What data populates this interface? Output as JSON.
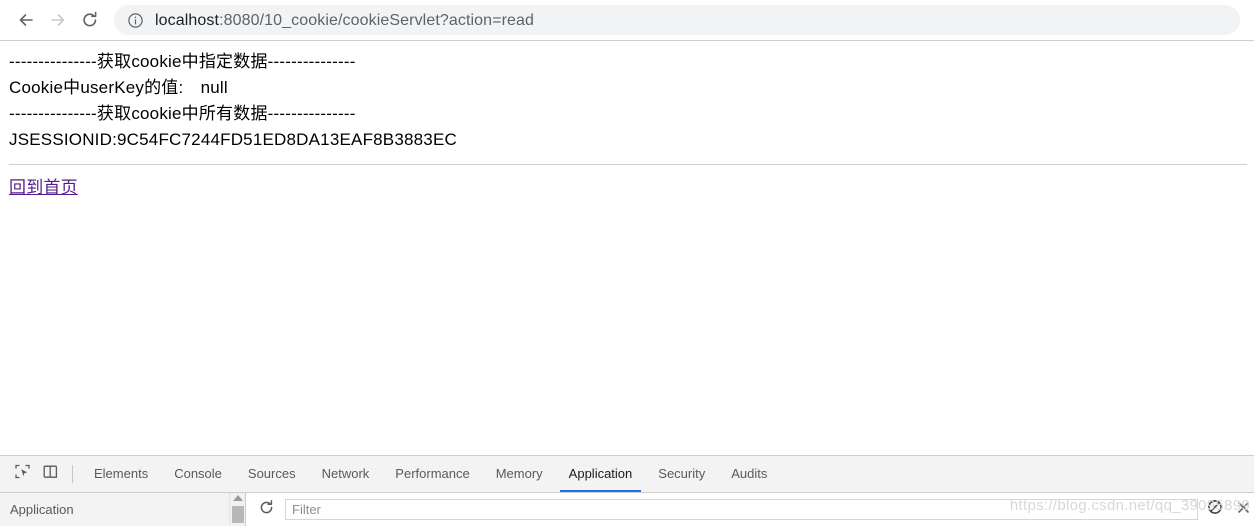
{
  "browser": {
    "back_icon": "back-arrow-icon",
    "forward_icon": "forward-arrow-icon",
    "reload_icon": "reload-icon",
    "site_info_icon": "info-circle-icon",
    "url_host": "localhost",
    "url_rest": ":8080/10_cookie/cookieServlet?action=read",
    "url_full": "localhost:8080/10_cookie/cookieServlet?action=read"
  },
  "page": {
    "lines": [
      "---------------获取cookie中指定数据---------------",
      "Cookie中userKey的值:　null",
      "---------------获取cookie中所有数据---------------",
      "JSESSIONID:9C54FC7244FD51ED8DA13EAF8B3883EC"
    ],
    "link_label": "回到首页",
    "link_color": "#551a8b"
  },
  "devtools": {
    "inspect_icon": "inspect-element-icon",
    "device_icon": "device-toolbar-icon",
    "tabs": [
      {
        "label": "Elements",
        "active": false
      },
      {
        "label": "Console",
        "active": false
      },
      {
        "label": "Sources",
        "active": false
      },
      {
        "label": "Network",
        "active": false
      },
      {
        "label": "Performance",
        "active": false
      },
      {
        "label": "Memory",
        "active": false
      },
      {
        "label": "Application",
        "active": true
      },
      {
        "label": "Security",
        "active": false
      },
      {
        "label": "Audits",
        "active": false
      }
    ],
    "active_tab": "Application",
    "active_underline_color": "#1a73e8",
    "sidebar_label": "Application",
    "refresh_icon": "refresh-icon",
    "filter_placeholder": "Filter",
    "filter_value": "",
    "clear_icon": "clear-ban-icon",
    "close_icon": "close-x-icon"
  },
  "watermark": {
    "text": "https://blog.csdn.net/qq_39095899"
  }
}
